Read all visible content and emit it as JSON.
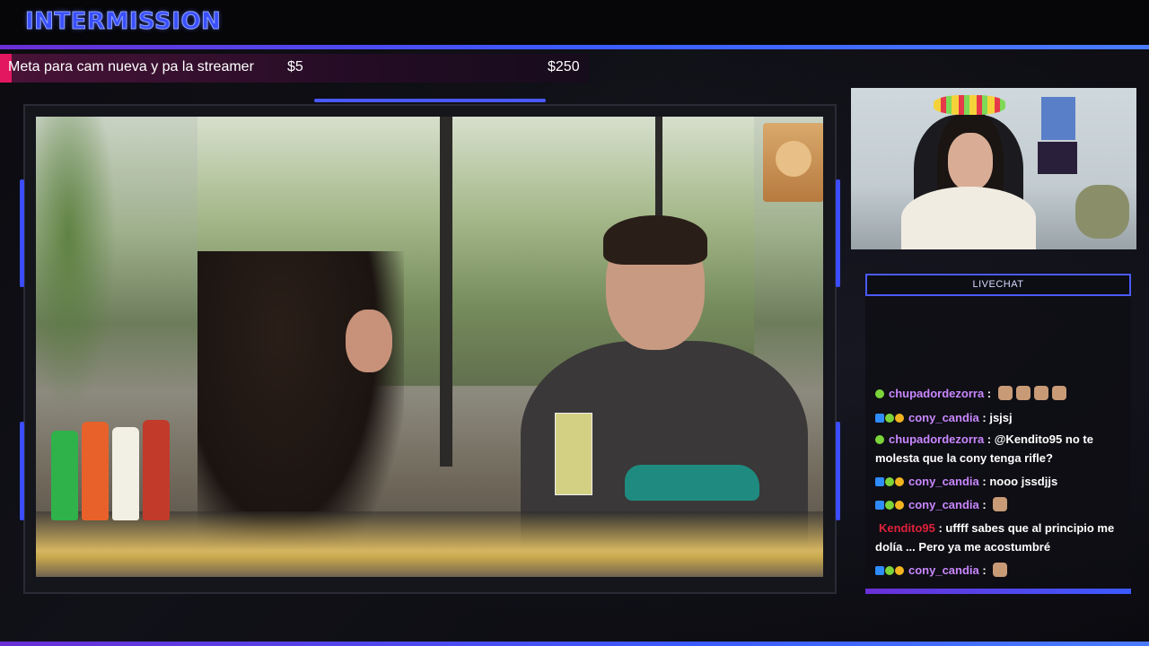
{
  "header": {
    "title": "INTERMISSION"
  },
  "goal": {
    "label": "Meta para cam nueva y pa la streamer",
    "current": "$5",
    "target": "$250",
    "progress_fraction": 0.02,
    "fill_color": "#e2175f"
  },
  "livechat": {
    "title": "LIVECHAT",
    "messages": [
      {
        "user": "chupadordezorra",
        "user_color": "#c987ff",
        "badges": [
          "green"
        ],
        "text": "",
        "emotes": 4
      },
      {
        "user": "cony_candia",
        "user_color": "#c987ff",
        "badges": [
          "blue",
          "green",
          "gold"
        ],
        "text": "jsjsj",
        "emotes": 0
      },
      {
        "user": "chupadordezorra",
        "user_color": "#c987ff",
        "badges": [
          "green"
        ],
        "text": "@Kendito95 no te molesta que la cony tenga rifle?",
        "emotes": 0
      },
      {
        "user": "cony_candia",
        "user_color": "#c987ff",
        "badges": [
          "blue",
          "green",
          "gold"
        ],
        "text": "nooo jssdjjs",
        "emotes": 0
      },
      {
        "user": "cony_candia",
        "user_color": "#c987ff",
        "badges": [
          "blue",
          "green",
          "gold"
        ],
        "text": "",
        "emotes": 1
      },
      {
        "user": "Kendito95",
        "user_color": "#e0213b",
        "badges": [],
        "text": "uffff sabes que al principio me dolía ... Pero ya me acostumbré",
        "emotes": 0
      },
      {
        "user": "cony_candia",
        "user_color": "#c987ff",
        "badges": [
          "blue",
          "green",
          "gold"
        ],
        "text": "",
        "emotes": 1
      }
    ]
  },
  "colors": {
    "accent_blue": "#3b4dff",
    "accent_purple": "#6a2fd6"
  }
}
